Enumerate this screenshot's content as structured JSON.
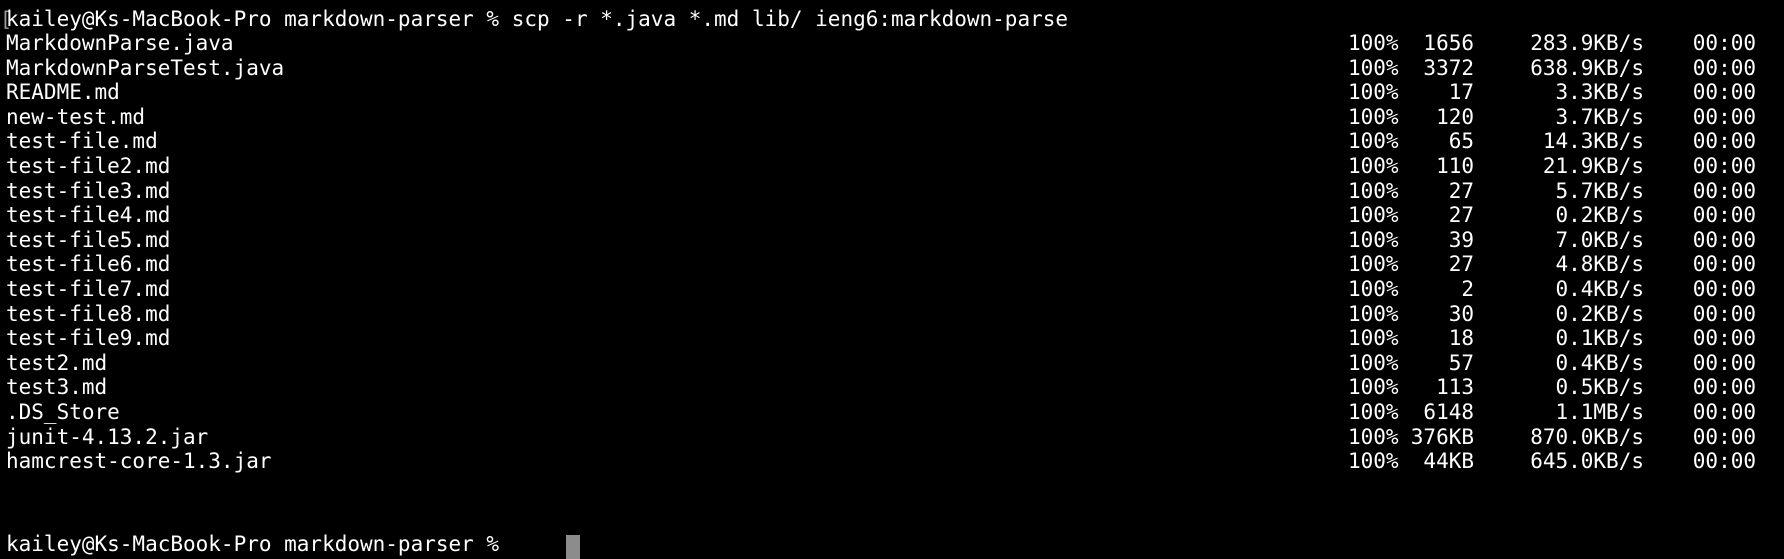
{
  "terminal": {
    "command_line": "kailey@Ks-MacBook-Pro markdown-parser % scp -r *.java *.md lib/ ieng6:markdown-parse",
    "next_prompt": "kailey@Ks-MacBook-Pro markdown-parser %",
    "colors": {
      "background": "#000000",
      "text": "#ffffff",
      "cursor": "#8c8c8c"
    },
    "transfers": [
      {
        "name": "MarkdownParse.java",
        "percent": "100%",
        "size": "1656",
        "rate": "283.9KB/s",
        "eta": "00:00"
      },
      {
        "name": "MarkdownParseTest.java",
        "percent": "100%",
        "size": "3372",
        "rate": "638.9KB/s",
        "eta": "00:00"
      },
      {
        "name": "README.md",
        "percent": "100%",
        "size": "17",
        "rate": "3.3KB/s",
        "eta": "00:00"
      },
      {
        "name": "new-test.md",
        "percent": "100%",
        "size": "120",
        "rate": "3.7KB/s",
        "eta": "00:00"
      },
      {
        "name": "test-file.md",
        "percent": "100%",
        "size": "65",
        "rate": "14.3KB/s",
        "eta": "00:00"
      },
      {
        "name": "test-file2.md",
        "percent": "100%",
        "size": "110",
        "rate": "21.9KB/s",
        "eta": "00:00"
      },
      {
        "name": "test-file3.md",
        "percent": "100%",
        "size": "27",
        "rate": "5.7KB/s",
        "eta": "00:00"
      },
      {
        "name": "test-file4.md",
        "percent": "100%",
        "size": "27",
        "rate": "0.2KB/s",
        "eta": "00:00"
      },
      {
        "name": "test-file5.md",
        "percent": "100%",
        "size": "39",
        "rate": "7.0KB/s",
        "eta": "00:00"
      },
      {
        "name": "test-file6.md",
        "percent": "100%",
        "size": "27",
        "rate": "4.8KB/s",
        "eta": "00:00"
      },
      {
        "name": "test-file7.md",
        "percent": "100%",
        "size": "2",
        "rate": "0.4KB/s",
        "eta": "00:00"
      },
      {
        "name": "test-file8.md",
        "percent": "100%",
        "size": "30",
        "rate": "0.2KB/s",
        "eta": "00:00"
      },
      {
        "name": "test-file9.md",
        "percent": "100%",
        "size": "18",
        "rate": "0.1KB/s",
        "eta": "00:00"
      },
      {
        "name": "test2.md",
        "percent": "100%",
        "size": "57",
        "rate": "0.4KB/s",
        "eta": "00:00"
      },
      {
        "name": "test3.md",
        "percent": "100%",
        "size": "113",
        "rate": "0.5KB/s",
        "eta": "00:00"
      },
      {
        "name": ".DS_Store",
        "percent": "100%",
        "size": "6148",
        "rate": "1.1MB/s",
        "eta": "00:00"
      },
      {
        "name": "junit-4.13.2.jar",
        "percent": "100%",
        "size": "376KB",
        "rate": "870.0KB/s",
        "eta": "00:00"
      },
      {
        "name": "hamcrest-core-1.3.jar",
        "percent": "100%",
        "size": "44KB",
        "rate": "645.0KB/s",
        "eta": "00:00"
      }
    ]
  }
}
